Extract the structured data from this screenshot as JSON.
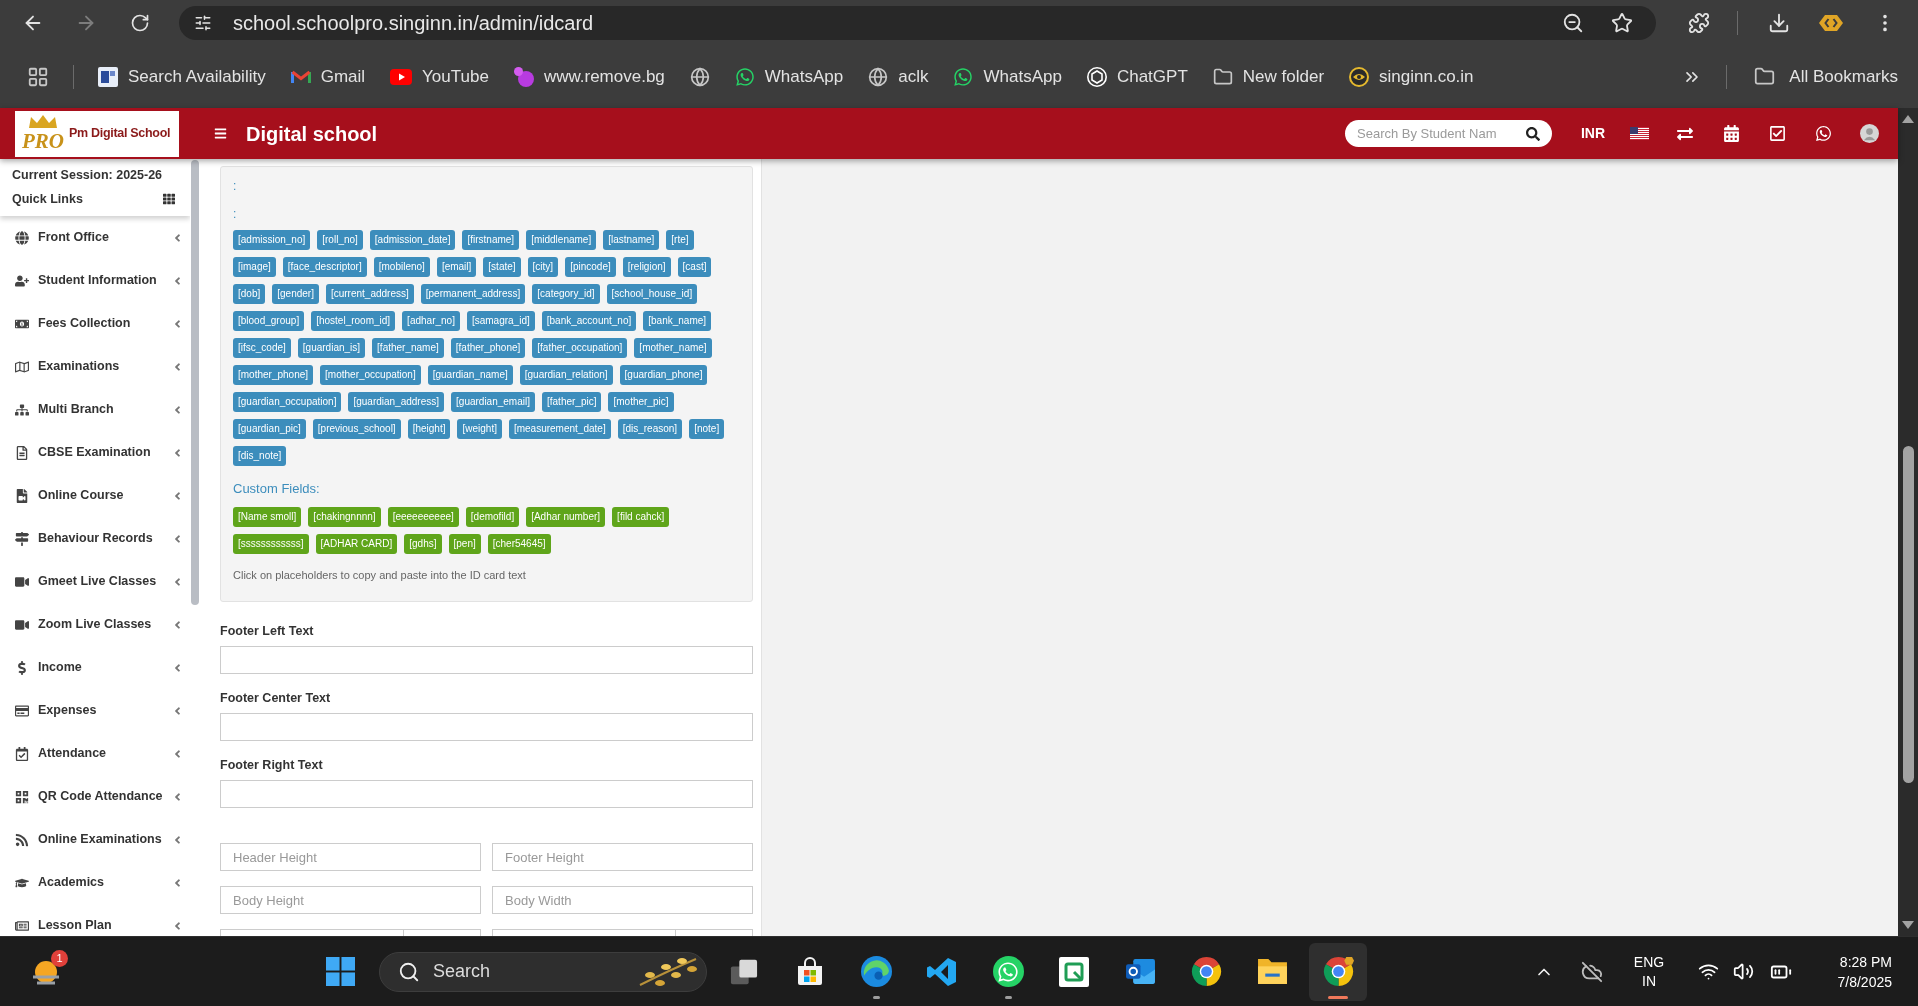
{
  "browser": {
    "url": "school.schoolpro.singinn.in/admin/idcard",
    "forward_disabled": true
  },
  "bookmarks": [
    {
      "kind": "site",
      "label": "Search Availability"
    },
    {
      "kind": "site",
      "label": "Gmail"
    },
    {
      "kind": "site",
      "label": "YouTube"
    },
    {
      "kind": "site",
      "label": "www.remove.bg"
    },
    {
      "kind": "icon"
    },
    {
      "kind": "site",
      "label": "WhatsApp"
    },
    {
      "kind": "site",
      "label": "aclk"
    },
    {
      "kind": "site",
      "label": "WhatsApp"
    },
    {
      "kind": "site",
      "label": "ChatGPT"
    },
    {
      "kind": "folder",
      "label": "New folder"
    },
    {
      "kind": "site",
      "label": "singinn.co.in"
    }
  ],
  "all_bookmarks": "All Bookmarks",
  "app_header": {
    "logo_mark": "PRO",
    "logo_name": "Pm Digital School",
    "title": "Digital school",
    "search": {
      "placeholder": "Search By Student Nam"
    },
    "currency": "INR"
  },
  "sidebar": {
    "session": "Current Session: 2025-26",
    "quick_links": "Quick Links",
    "items": [
      {
        "label": "Front Office"
      },
      {
        "label": "Student Information"
      },
      {
        "label": "Fees Collection"
      },
      {
        "label": "Examinations"
      },
      {
        "label": "Multi Branch"
      },
      {
        "label": "CBSE Examination"
      },
      {
        "label": "Online Course"
      },
      {
        "label": "Behaviour Records"
      },
      {
        "label": "Gmeet Live Classes"
      },
      {
        "label": "Zoom Live Classes"
      },
      {
        "label": "Income"
      },
      {
        "label": "Expenses"
      },
      {
        "label": "Attendance"
      },
      {
        "label": "QR Code Attendance"
      },
      {
        "label": "Online Examinations"
      },
      {
        "label": "Academics"
      },
      {
        "label": "Lesson Plan"
      }
    ]
  },
  "placeholder_panel": {
    "lines": [
      ":",
      ":"
    ],
    "placeholders": [
      "[admission_no]",
      "[roll_no]",
      "[admission_date]",
      "[firstname]",
      "[middlename]",
      "[lastname]",
      "[rte]",
      "[image]",
      "[face_descriptor]",
      "[mobileno]",
      "[email]",
      "[state]",
      "[city]",
      "[pincode]",
      "[religion]",
      "[cast]",
      "[dob]",
      "[gender]",
      "[current_address]",
      "[permanent_address]",
      "[category_id]",
      "[school_house_id]",
      "[blood_group]",
      "[hostel_room_id]",
      "[adhar_no]",
      "[samagra_id]",
      "[bank_account_no]",
      "[bank_name]",
      "[ifsc_code]",
      "[guardian_is]",
      "[father_name]",
      "[father_phone]",
      "[father_occupation]",
      "[mother_name]",
      "[mother_phone]",
      "[mother_occupation]",
      "[guardian_name]",
      "[guardian_relation]",
      "[guardian_phone]",
      "[guardian_occupation]",
      "[guardian_address]",
      "[guardian_email]",
      "[father_pic]",
      "[mother_pic]",
      "[guardian_pic]",
      "[previous_school]",
      "[height]",
      "[weight]",
      "[measurement_date]",
      "[dis_reason]",
      "[note]",
      "[dis_note]"
    ],
    "custom_fields_label": "Custom Fields:",
    "custom_fields": [
      "[Name smoll]",
      "[chakingnnnn]",
      "[eeeeeeeeee]",
      "[demofild]",
      "[Adhar number]",
      "[fild cahck]",
      "[ssssssssssss]",
      "[ADHAR CARD]",
      "[gdhs]",
      "[pen]",
      "[cher54645]"
    ],
    "hint": "Click on placeholders to copy and paste into the ID card text"
  },
  "form": {
    "text_fields": [
      {
        "label": "Footer Left Text"
      },
      {
        "label": "Footer Center Text"
      },
      {
        "label": "Footer Right Text"
      }
    ],
    "size_fields": [
      {
        "placeholder": "Header Height"
      },
      {
        "placeholder": "Footer Height"
      },
      {
        "placeholder": "Body Height"
      },
      {
        "placeholder": "Body Width"
      }
    ]
  },
  "taskbar": {
    "notification_badge": "1",
    "search": "Search",
    "apps": [
      {
        "running": false,
        "selected": false
      },
      {
        "running": false,
        "selected": false
      },
      {
        "running": true,
        "selected": false
      },
      {
        "running": false,
        "selected": false
      },
      {
        "running": true,
        "selected": false
      },
      {
        "running": false,
        "selected": false
      },
      {
        "running": false,
        "selected": false
      },
      {
        "running": false,
        "selected": false
      },
      {
        "running": false,
        "selected": false
      },
      {
        "running": true,
        "selected": true
      }
    ],
    "language": "ENG",
    "region": "IN",
    "time": "8:28 PM",
    "date": "7/8/2025"
  }
}
